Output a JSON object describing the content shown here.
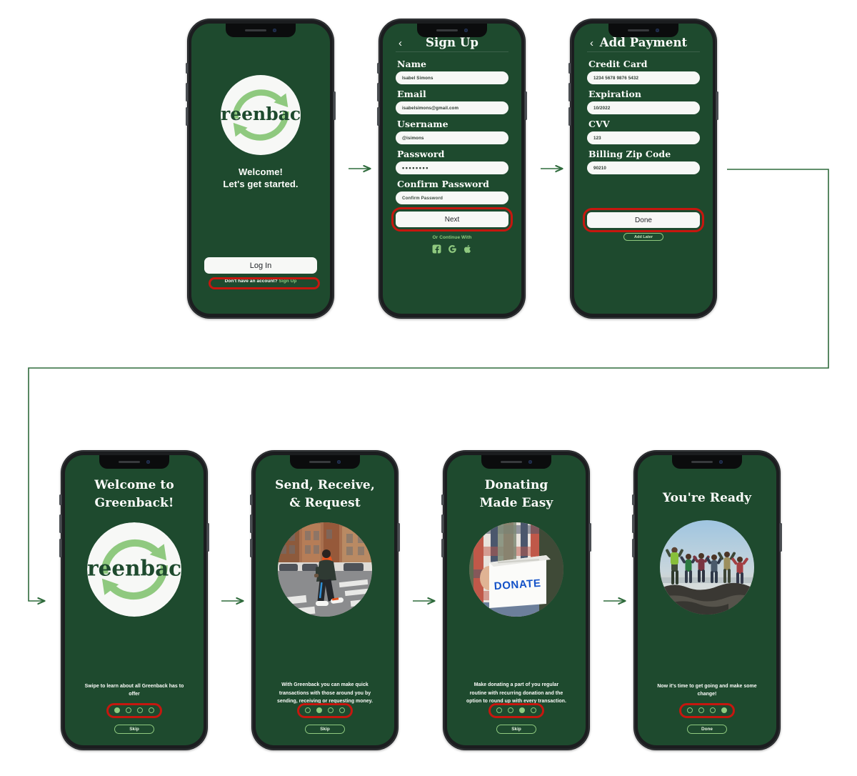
{
  "brand": {
    "name": "greenback",
    "dark_green": "#1e4a2e",
    "light_green": "#8fc97f",
    "white": "#f7f8f6",
    "highlight_red": "#c6170f",
    "connector_green": "#2f6b3c"
  },
  "screens": {
    "welcome": {
      "logo_text": "greenback",
      "headline_line1": "Welcome!",
      "headline_line2": "Let's get started.",
      "login_label": "Log In",
      "signup_prompt": "Don't have an account? ",
      "signup_link": "Sign Up"
    },
    "signup": {
      "title": "Sign Up",
      "back_icon": "‹",
      "fields": [
        {
          "label": "Name",
          "value": "Isabel Simons",
          "placeholder": "Name",
          "type": "text"
        },
        {
          "label": "Email",
          "value": "isabelsimons@gmail.com",
          "placeholder": "Email",
          "type": "text"
        },
        {
          "label": "Username",
          "value": "@isimons",
          "placeholder": "Username",
          "type": "text"
        },
        {
          "label": "Password",
          "value": "••••••••",
          "placeholder": "Password",
          "type": "password"
        },
        {
          "label": "Confirm Password",
          "value": "Confirm Password",
          "placeholder": "Confirm Password",
          "type": "placeholder"
        }
      ],
      "next_label": "Next",
      "continue_label": "Or Continue With",
      "social_icons": [
        "facebook-icon",
        "google-icon",
        "apple-icon"
      ]
    },
    "payment": {
      "title": "Add Payment",
      "back_icon": "‹",
      "fields": [
        {
          "label": "Credit Card",
          "value": "1234 5678 9876 5432",
          "placeholder": "Credit Card"
        },
        {
          "label": "Expiration",
          "value": "10/2022",
          "placeholder": "Expiration"
        },
        {
          "label": "CVV",
          "value": "123",
          "placeholder": "CVV"
        },
        {
          "label": "Billing Zip Code",
          "value": "90210",
          "placeholder": "Billing Zip Code"
        }
      ],
      "done_label": "Done",
      "add_later_label": "Add Later"
    },
    "onboarding": [
      {
        "title_line1": "Welcome to",
        "title_line2": "Greenback!",
        "media": "greenback-logo",
        "body": "Swipe to learn about all Greenback has to offer",
        "dots_total": 4,
        "dot_active": 1,
        "button_label": "Skip"
      },
      {
        "title_line1": "Send, Receive,",
        "title_line2": "& Request",
        "media": "man-walking-crosswalk-photo",
        "body": "With Greenback you can make quick transactions with those around you by sending, receiving or requesting money.",
        "dots_total": 4,
        "dot_active": 2,
        "button_label": "Skip"
      },
      {
        "title_line1": "Donating",
        "title_line2": "Made Easy",
        "media": "person-holding-donate-box-photo",
        "media_text": "DONATE",
        "body": "Make donating a part of you regular routine with recurring donation and the option to round up with every transaction.",
        "dots_total": 4,
        "dot_active": 3,
        "button_label": "Skip"
      },
      {
        "title_line1": "You're Ready",
        "title_line2": "",
        "media": "people-jumping-beach-photo",
        "body": "Now it's time to get going and make some change!",
        "dots_total": 4,
        "dot_active": 4,
        "button_label": "Done"
      }
    ]
  }
}
